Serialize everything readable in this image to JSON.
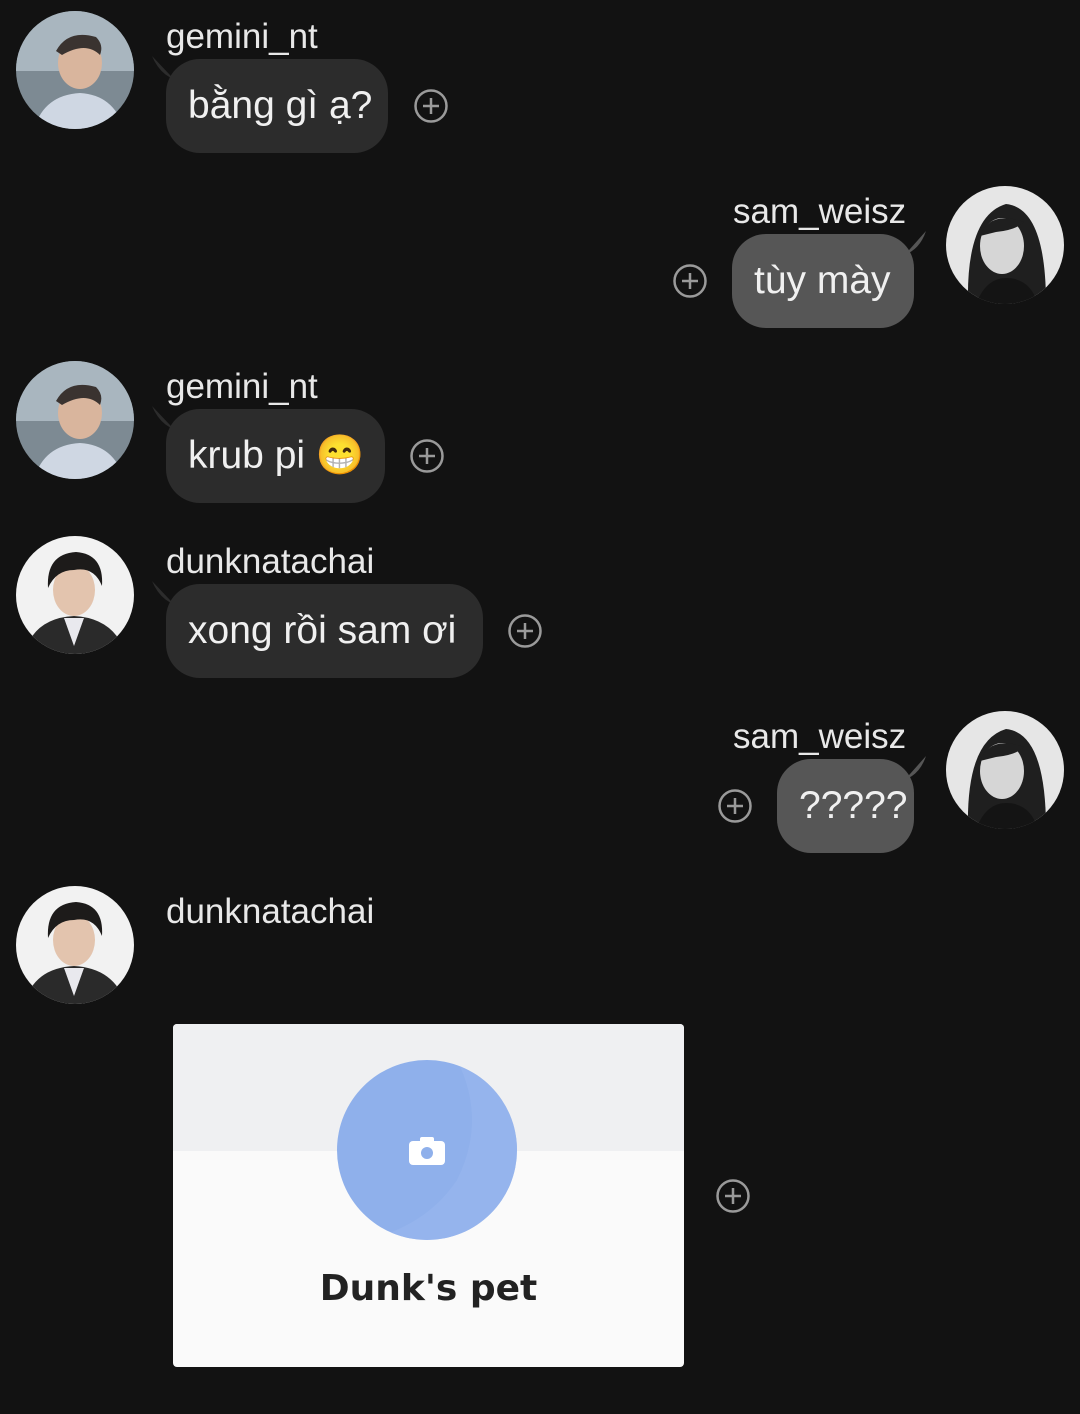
{
  "messages": [
    {
      "sender": "gemini_nt",
      "text": "bằng gì ạ?",
      "direction": "incoming"
    },
    {
      "sender": "sam_weisz",
      "text": "tùy mày",
      "direction": "outgoing"
    },
    {
      "sender": "gemini_nt",
      "text": "krub pi 😁",
      "direction": "incoming"
    },
    {
      "sender": "dunknatachai",
      "text": "xong rồi sam ơi",
      "direction": "incoming"
    },
    {
      "sender": "sam_weisz",
      "text": "?????",
      "direction": "outgoing"
    },
    {
      "sender": "dunknatachai",
      "direction": "incoming",
      "attachment": {
        "type": "pet-card",
        "title": "Dunk's pet",
        "icon": "camera-icon"
      }
    }
  ],
  "icons": {
    "reaction": "add-reaction-icon"
  },
  "colors": {
    "background": "#121212",
    "incoming_bubble": "#2c2c2c",
    "outgoing_bubble": "#565656",
    "card_accent": "#8fb0eb"
  }
}
